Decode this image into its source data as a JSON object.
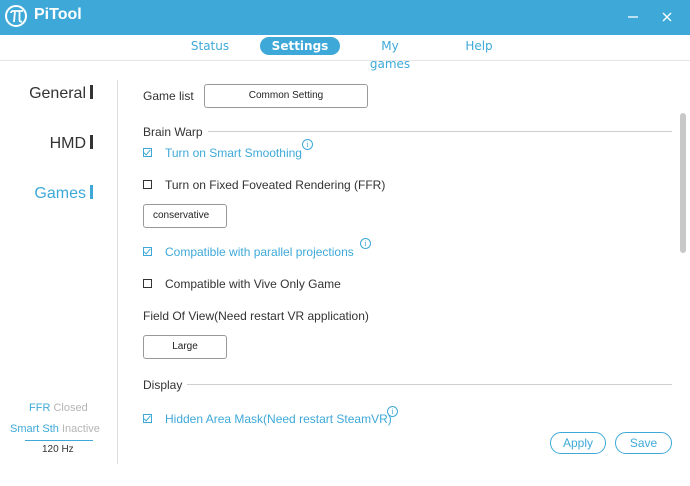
{
  "app": {
    "title": "PiTool"
  },
  "nav": {
    "tabs": [
      {
        "label": "Status"
      },
      {
        "label": "Settings",
        "active": true
      },
      {
        "label": "My games"
      },
      {
        "label": "Help"
      }
    ]
  },
  "sidebar": {
    "items": [
      {
        "label": "General"
      },
      {
        "label": "HMD"
      },
      {
        "label": "Games",
        "active": true
      }
    ]
  },
  "status": {
    "ffr_label": "FFR",
    "ffr_value": "Closed",
    "smart_label": "Smart Sth",
    "smart_value": "Inactive",
    "refresh": "120 Hz"
  },
  "main": {
    "game_list_label": "Game list",
    "game_list_value": "Common Setting",
    "brain_warp": {
      "title": "Brain Warp",
      "smart_smoothing": {
        "label": "Turn on Smart Smoothing",
        "checked": true
      },
      "ffr": {
        "label": "Turn on Fixed Foveated Rendering (FFR)",
        "checked": false
      },
      "ffr_mode": "conservative",
      "parallel": {
        "label": "Compatible with parallel projections",
        "checked": true
      },
      "vive_only": {
        "label": "Compatible with Vive Only Game",
        "checked": false
      },
      "fov_label": "Field Of View(Need restart VR application)",
      "fov_value": "Large"
    },
    "display": {
      "title": "Display",
      "hidden_area_mask": {
        "label": "Hidden Area Mask(Need restart SteamVR)",
        "checked": true
      }
    }
  },
  "actions": {
    "apply": "Apply",
    "save": "Save"
  },
  "colors": {
    "accent": "#3ea9d8",
    "text": "#333333",
    "muted": "#b5b5b5"
  },
  "icons": [
    "pi-logo-icon",
    "minimize-icon",
    "close-icon",
    "info-icon",
    "checkbox-icon"
  ]
}
